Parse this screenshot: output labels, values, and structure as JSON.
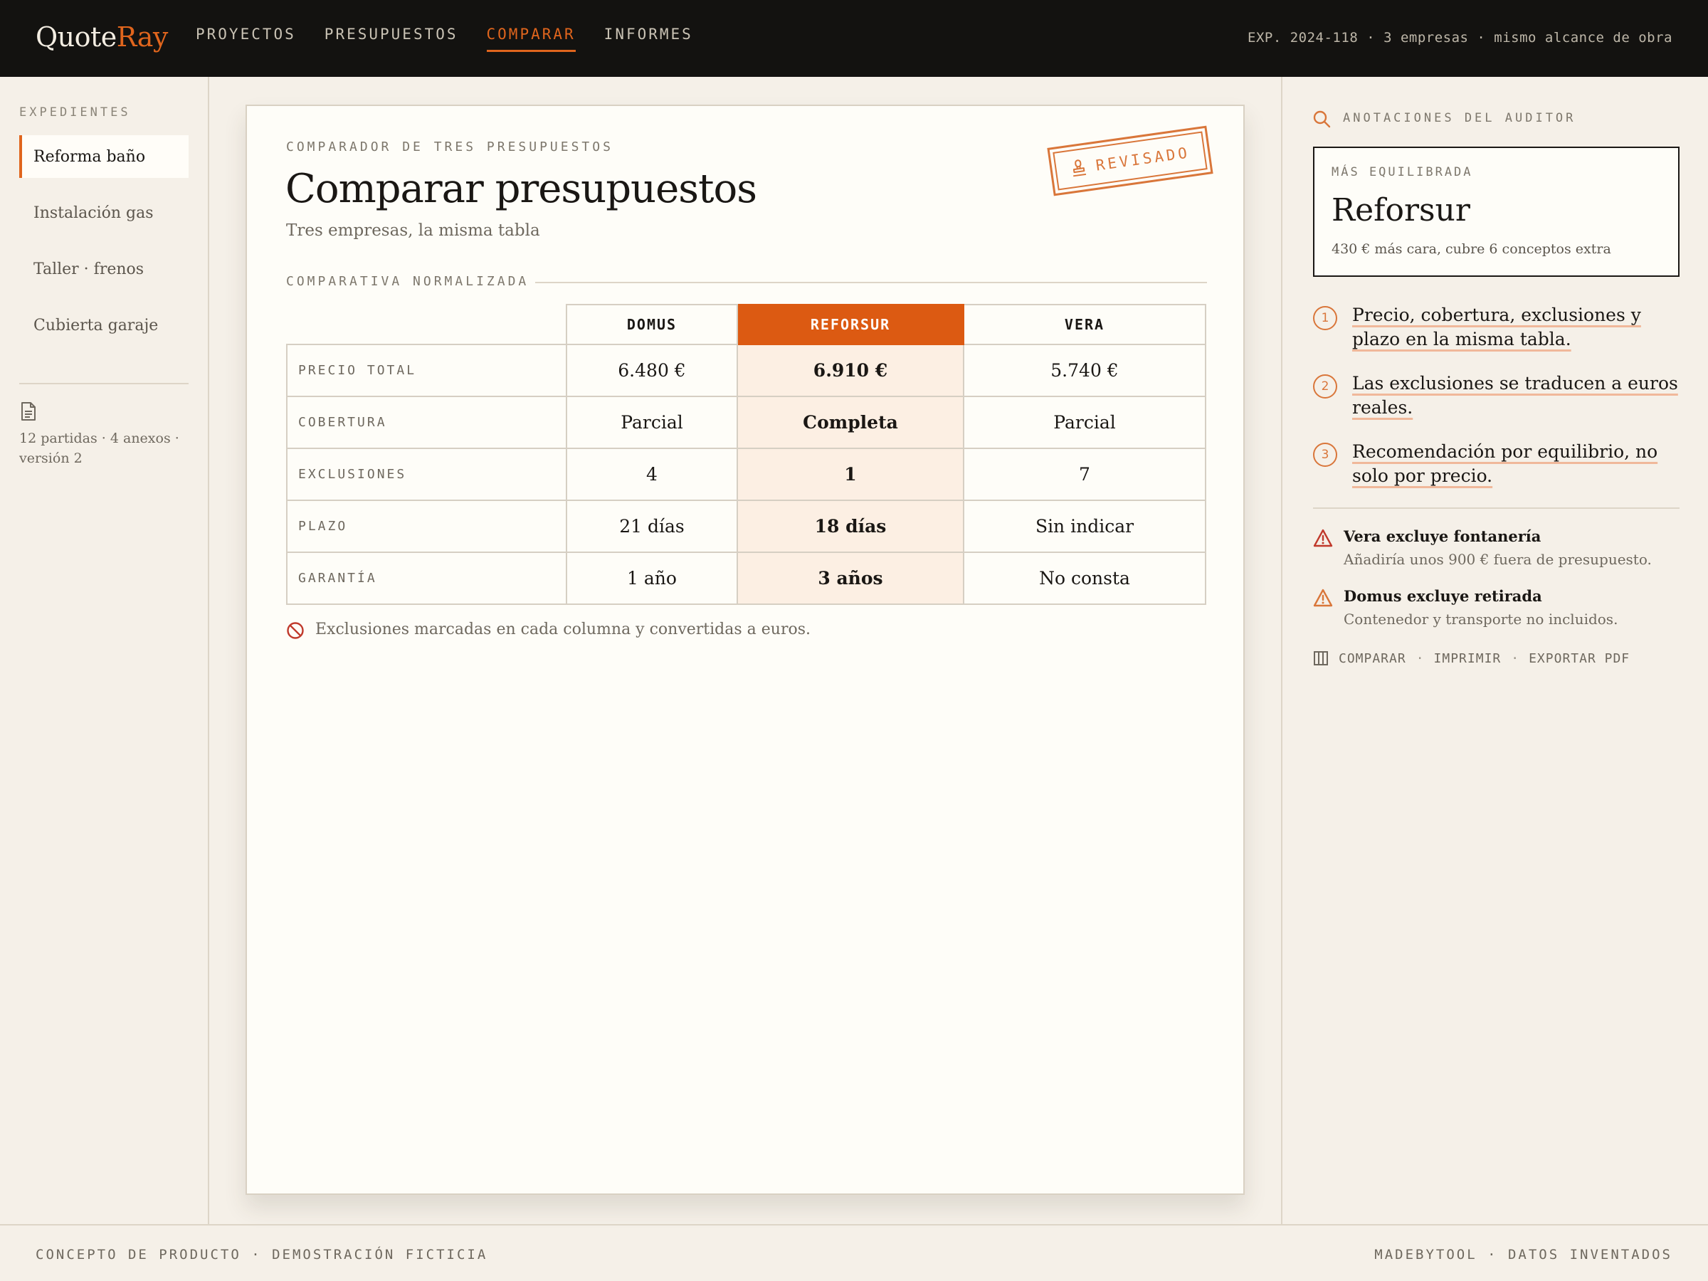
{
  "brand": {
    "part1": "Quote",
    "part2": "Ray"
  },
  "nav": [
    {
      "label": "PROYECTOS"
    },
    {
      "label": "PRESUPUESTOS"
    },
    {
      "label": "COMPARAR",
      "active": true
    },
    {
      "label": "INFORMES"
    }
  ],
  "top_meta": "EXP. 2024-118 · 3 empresas · mismo alcance de obra",
  "sidebar": {
    "heading": "EXPEDIENTES",
    "items": [
      {
        "label": "Reforma baño",
        "active": true
      },
      {
        "label": "Instalación gas"
      },
      {
        "label": "Taller · frenos"
      },
      {
        "label": "Cubierta garaje"
      }
    ],
    "meta": "12 partidas · 4 anexos · versión 2"
  },
  "main": {
    "eyebrow": "COMPARADOR DE TRES PRESUPUESTOS",
    "title": "Comparar presupuestos",
    "subtitle": "Tres empresas, la misma tabla",
    "stamp": "REVISADO",
    "section_label": "COMPARATIVA NORMALIZADA",
    "table": {
      "columns": [
        "DOMUS",
        "REFORSUR",
        "VERA"
      ],
      "highlight_column": 1,
      "rows": [
        {
          "label": "PRECIO TOTAL",
          "values": [
            "6.480 €",
            "6.910 €",
            "5.740 €"
          ]
        },
        {
          "label": "COBERTURA",
          "values": [
            "Parcial",
            "Completa",
            "Parcial"
          ]
        },
        {
          "label": "EXCLUSIONES",
          "values": [
            "4",
            "1",
            "7"
          ]
        },
        {
          "label": "PLAZO",
          "values": [
            "21 días",
            "18 días",
            "Sin indicar"
          ]
        },
        {
          "label": "GARANTÍA",
          "values": [
            "1 año",
            "3 años",
            "No consta"
          ]
        }
      ]
    },
    "note": "Exclusiones marcadas en cada columna y convertidas a euros."
  },
  "right_panel": {
    "heading": "ANOTACIONES DEL AUDITOR",
    "best": {
      "eyebrow": "MÁS EQUILIBRADA",
      "name": "Reforsur",
      "sub": "430 € más cara, cubre 6 conceptos extra"
    },
    "points": [
      {
        "num": "1",
        "text": "Precio, cobertura, exclusiones y plazo en la misma tabla."
      },
      {
        "num": "2",
        "text": "Las exclusiones se traducen a euros reales."
      },
      {
        "num": "3",
        "text": "Recomendación por equilibrio, no solo por precio."
      }
    ],
    "warnings": [
      {
        "title": "Vera excluye fontanería",
        "sub": "Añadiría unos 900 € fuera de presupuesto."
      },
      {
        "title": "Domus excluye retirada",
        "sub": "Contenedor y transporte no incluidos."
      }
    ],
    "actions": [
      "COMPARAR",
      "IMPRIMIR",
      "EXPORTAR PDF"
    ]
  },
  "footer": {
    "left": "CONCEPTO DE PRODUCTO · DEMOSTRACIÓN FICTICIA",
    "right": "MADEBYTOOL · DATOS INVENTADOS"
  },
  "colors": {
    "accent": "#e0651d",
    "accent_fill": "#dc5a12",
    "highlight_cell": "#fcefe3",
    "topbar": "#131210",
    "page_bg": "#f5f0e8",
    "card_bg": "#fefdf8",
    "warning_red": "#c0392b",
    "warning_orange": "#d9763a"
  },
  "icons": {
    "side_doc": "document-icon",
    "stamp": "stamp-icon",
    "note": "prohibited-icon",
    "panel_head": "search-icon",
    "warning": "warning-triangle-icon",
    "actions": "columns-icon"
  }
}
